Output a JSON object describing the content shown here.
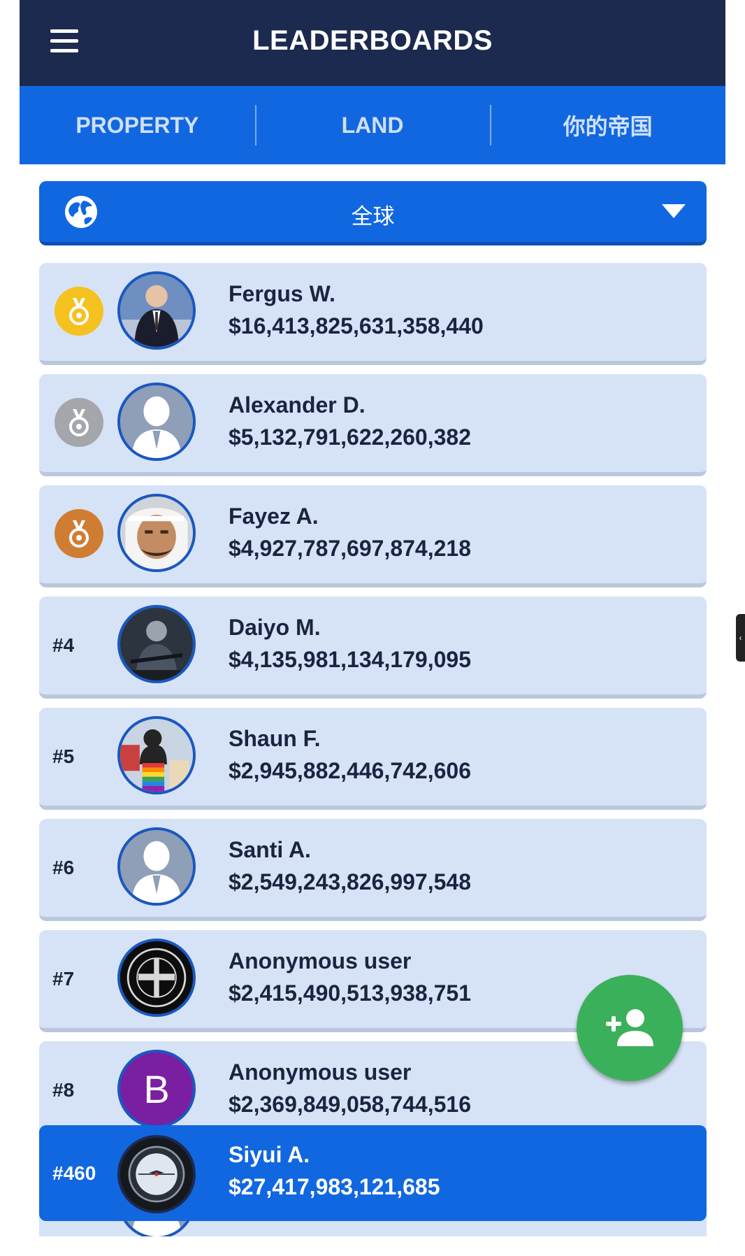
{
  "header": {
    "title": "LEADERBOARDS",
    "menu_icon": "hamburger-menu-icon"
  },
  "tabs": [
    {
      "label": "PROPERTY"
    },
    {
      "label": "LAND"
    },
    {
      "label": "你的帝国"
    }
  ],
  "region_selector": {
    "icon": "globe-icon",
    "label": "全球",
    "caret_icon": "caret-down-icon"
  },
  "leaderboard": {
    "rows": [
      {
        "rank": "",
        "medal": "gold-medal-icon",
        "name": "Fergus W.",
        "amount": "$16,413,825,631,358,440",
        "avatar": "photo"
      },
      {
        "rank": "",
        "medal": "silver-medal-icon",
        "name": "Alexander D.",
        "amount": "$5,132,791,622,260,382",
        "avatar": "default-person"
      },
      {
        "rank": "",
        "medal": "bronze-medal-icon",
        "name": "Fayez A.",
        "amount": "$4,927,787,697,874,218",
        "avatar": "photo"
      },
      {
        "rank": "#4",
        "name": "Daiyo M.",
        "amount": "$4,135,981,134,179,095",
        "avatar": "photo"
      },
      {
        "rank": "#5",
        "name": "Shaun F.",
        "amount": "$2,945,882,446,742,606",
        "avatar": "photo"
      },
      {
        "rank": "#6",
        "name": "Santi A.",
        "amount": "$2,549,243,826,997,548",
        "avatar": "default-person"
      },
      {
        "rank": "#7",
        "name": "Anonymous user",
        "amount": "$2,415,490,513,938,751",
        "avatar": "emblem"
      },
      {
        "rank": "#8",
        "name": "Anonymous user",
        "amount": "$2,369,849,058,744,516",
        "avatar": "letter",
        "avatar_letter": "B"
      }
    ],
    "current_user": {
      "rank": "#460",
      "name": "Siyui A.",
      "amount": "$27,417,983,121,685",
      "avatar": "watch"
    }
  },
  "fab": {
    "icon": "add-person-icon"
  },
  "colors": {
    "header_bg": "#1d2a4f",
    "accent": "#1167e0",
    "row_bg": "#d6e3f6",
    "fab": "#3bb05a",
    "gold": "#f4c11f",
    "silver": "#a4a6ab",
    "bronze": "#d07d34",
    "letter_avatar": "#7a1fa2"
  }
}
